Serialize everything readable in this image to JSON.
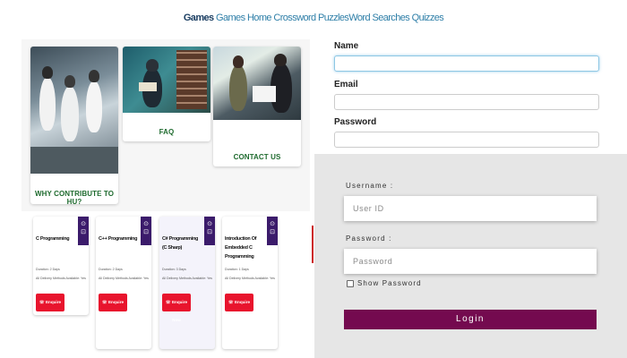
{
  "nav": {
    "brand": "Games",
    "links": [
      "Games",
      "Home",
      "Crossword Puzzles",
      "Word Searches",
      "Quizzes"
    ]
  },
  "tiles": {
    "contribute": "WHY CONTRIBUTE TO HU?",
    "faq": "FAQ",
    "contact": "CONTACT US"
  },
  "courses": [
    {
      "title": "C Programming",
      "duration": "Duration: 2 Days",
      "delivery": "All Delivery Methods Available: Yes",
      "button": "Enquire Now"
    },
    {
      "title": "C++ Programming",
      "duration": "Duration: 2 Days",
      "delivery": "All Delivery Methods Available: Yes",
      "button": "Enquire Now"
    },
    {
      "title": "C# Programming (C Sharp)",
      "duration": "Duration: 3 Days",
      "delivery": "All Delivery Methods Available: Yes",
      "button": "Enquire Now"
    },
    {
      "title": "Introduction Of Embedded C Programming",
      "duration": "Duration: 1 Days",
      "delivery": "All Delivery Methods Available: Yes",
      "button": "Enquire Now"
    }
  ],
  "registration": {
    "name_label": "Name",
    "name_value": "",
    "email_label": "Email",
    "email_value": "",
    "password_label": "Password",
    "password_value": ""
  },
  "login": {
    "username_label": "Username :",
    "username_placeholder": "User ID",
    "password_label": "Password :",
    "password_placeholder": "Password",
    "show_password_label": "Show Password",
    "login_button": "Login"
  },
  "colors": {
    "login_button": "#740a4f",
    "course_ribbon": "#3b1b6b",
    "enquire_button": "#e8142d",
    "tile_label": "#1f6b2f",
    "nav_link": "#2f7fa8"
  },
  "icons": {
    "course_ribbon": "cart-icon",
    "enquire": "phone-icon"
  }
}
